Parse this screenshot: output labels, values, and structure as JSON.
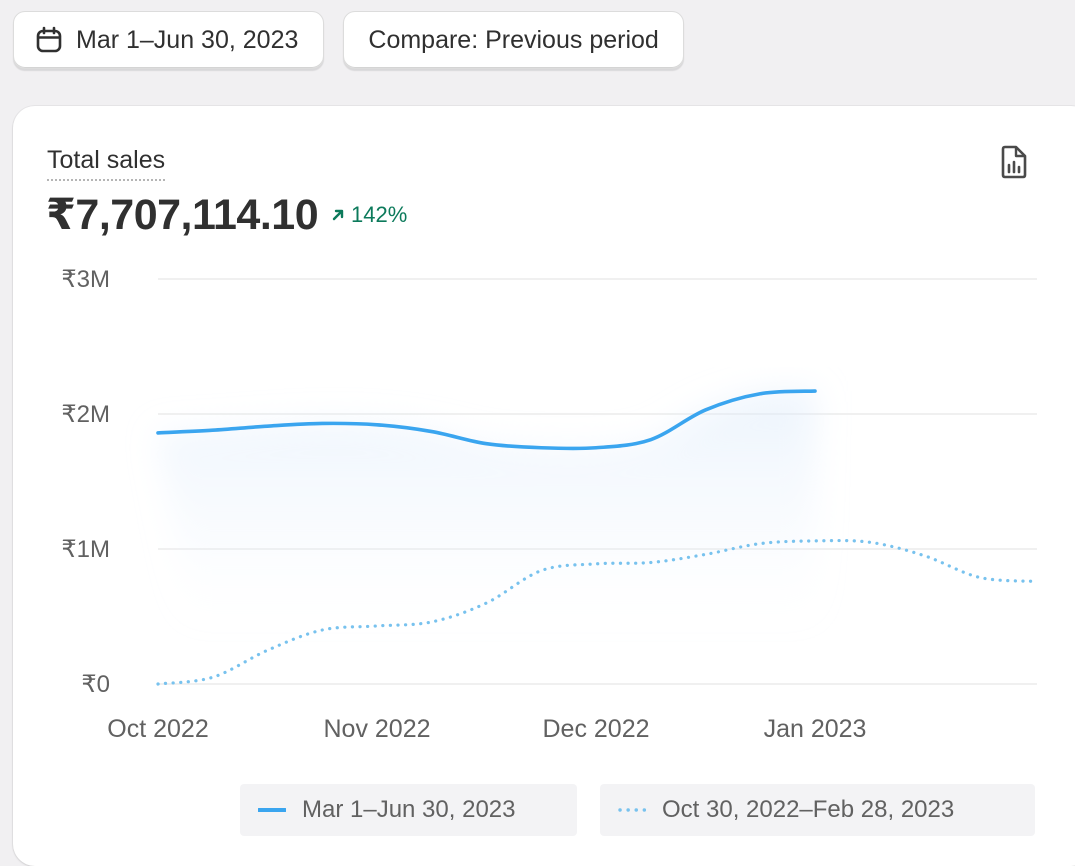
{
  "toolbar": {
    "date_range_label": "Mar 1–Jun 30, 2023",
    "date_icon": "calendar-icon",
    "compare_label": "Compare: Previous period"
  },
  "card": {
    "metric_title": "Total sales",
    "metric_value": "₹7,707,114.10",
    "change_text": "142%",
    "change_icon": "arrow-up-right-icon",
    "change_color": "#0c7a5b",
    "report_icon": "report-icon"
  },
  "chart_data": {
    "type": "line",
    "title": "",
    "xlabel": "",
    "ylabel": "",
    "y_ticks": [
      "₹0",
      "₹1M",
      "₹2M",
      "₹3M"
    ],
    "ylim": [
      0,
      3000000
    ],
    "x_ticks": [
      "Oct 2022",
      "Nov 2022",
      "Dec 2022",
      "Jan 2023"
    ],
    "grid": true,
    "legend_position": "bottom-right",
    "series": [
      {
        "name": "Mar 1–Jun 30, 2023",
        "style": "solid",
        "color": "#3aa5ef",
        "points": [
          [
            0,
            1860000
          ],
          [
            0.25,
            1880000
          ],
          [
            0.5,
            1910000
          ],
          [
            0.75,
            1930000
          ],
          [
            1.0,
            1920000
          ],
          [
            1.25,
            1870000
          ],
          [
            1.5,
            1780000
          ],
          [
            1.75,
            1750000
          ],
          [
            2.0,
            1750000
          ],
          [
            2.25,
            1810000
          ],
          [
            2.5,
            2030000
          ],
          [
            2.75,
            2150000
          ],
          [
            3.0,
            2170000
          ]
        ]
      },
      {
        "name": "Oct 30, 2022–Feb 28, 2023",
        "style": "dotted",
        "color": "#78c2ee",
        "points": [
          [
            0,
            0
          ],
          [
            0.25,
            50000
          ],
          [
            0.5,
            250000
          ],
          [
            0.75,
            400000
          ],
          [
            1.0,
            430000
          ],
          [
            1.25,
            460000
          ],
          [
            1.5,
            600000
          ],
          [
            1.75,
            840000
          ],
          [
            2.0,
            890000
          ],
          [
            2.25,
            900000
          ],
          [
            2.5,
            960000
          ],
          [
            2.75,
            1040000
          ],
          [
            3.0,
            1060000
          ],
          [
            3.25,
            1050000
          ],
          [
            3.5,
            950000
          ],
          [
            3.75,
            790000
          ],
          [
            4.0,
            760000
          ]
        ]
      }
    ]
  }
}
